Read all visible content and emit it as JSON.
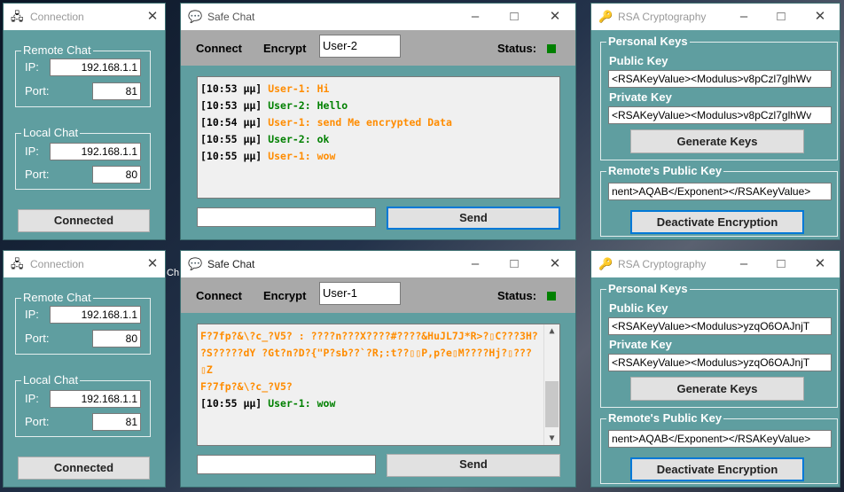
{
  "connection": {
    "title": "Connection",
    "remote_group": "Remote Chat",
    "local_group": "Local Chat",
    "ip_label": "IP:",
    "port_label": "Port:",
    "instances": [
      {
        "remote_ip": "192.168.1.1",
        "remote_port": "81",
        "local_ip": "192.168.1.1",
        "local_port": "80",
        "button": "Connected"
      },
      {
        "remote_ip": "192.168.1.1",
        "remote_port": "80",
        "local_ip": "192.168.1.1",
        "local_port": "81",
        "button": "Connected"
      }
    ]
  },
  "chat": {
    "title": "Safe Chat",
    "connect_menu": "Connect",
    "encrypt_menu": "Encrypt",
    "status_label": "Status:",
    "send_label": "Send",
    "status_color": "#008000",
    "instances": [
      {
        "user": "User-2",
        "messages": [
          {
            "time": "[10:53 μμ]",
            "user": "User-1:",
            "text": "Hi",
            "who": "u1"
          },
          {
            "time": "[10:53 μμ]",
            "user": "User-2:",
            "text": "Hello",
            "who": "u2"
          },
          {
            "time": "[10:54 μμ]",
            "user": "User-1:",
            "text": "send Me encrypted Data",
            "who": "u1"
          },
          {
            "time": "[10:55 μμ]",
            "user": "User-2:",
            "text": "ok",
            "who": "u2"
          },
          {
            "time": "[10:55 μμ]",
            "user": "User-1:",
            "text": "wow",
            "who": "u1"
          }
        ]
      },
      {
        "user": "User-1",
        "encrypted_lines": [
          "F?7fp?&\\?c_?V5? : ????n???X????#????&HuJL7J*R>?▯C???3H?",
          "?S?????dY ?Gt?n?D?{\"P?sb??`?R;:t??▯▯P,p?e▯M????Hj?▯???▯Z",
          "F?7fp?&\\?c_?V5?"
        ],
        "messages": [
          {
            "time": "[10:55 μμ]",
            "user": "User-1:",
            "text": "wow",
            "who": "u2"
          }
        ]
      }
    ]
  },
  "rsa": {
    "title": "RSA Cryptography",
    "personal_group": "Personal Keys",
    "public_label": "Public Key",
    "private_label": "Private Key",
    "generate_label": "Generate Keys",
    "remote_group": "Remote's Public Key",
    "deactivate_label": "Deactivate Encryption",
    "instances": [
      {
        "public_key": "<RSAKeyValue><Modulus>v8pCzl7glhWv",
        "private_key": "<RSAKeyValue><Modulus>v8pCzl7glhWv",
        "remote_key": "nent>AQAB</Exponent></RSAKeyValue>"
      },
      {
        "public_key": "<RSAKeyValue><Modulus>yzqO6OAJnjT",
        "private_key": "<RSAKeyValue><Modulus>yzqO6OAJnjT",
        "remote_key": "nent>AQAB</Exponent></RSAKeyValue>"
      }
    ]
  },
  "desktop": {
    "fragment": "Ch"
  }
}
